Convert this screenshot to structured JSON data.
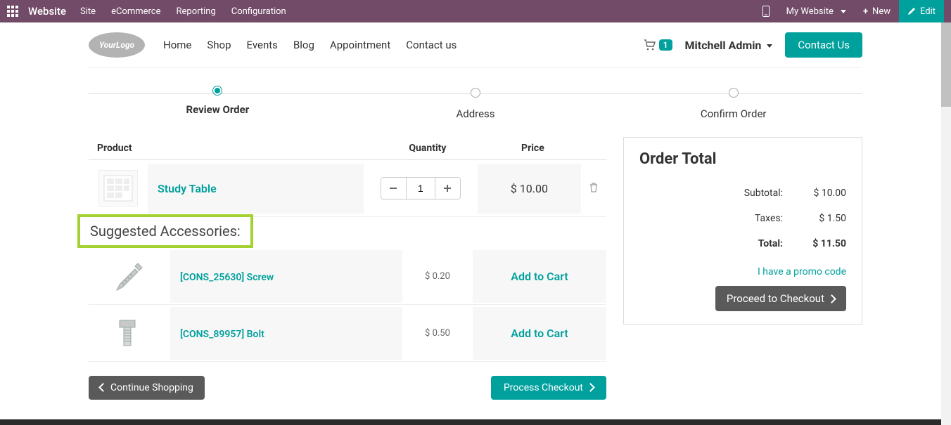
{
  "topbar": {
    "brand": "Website",
    "menu": [
      "Site",
      "eCommerce",
      "Reporting",
      "Configuration"
    ],
    "my_website": "My Website",
    "new": "New",
    "edit": "Edit"
  },
  "sitenav": {
    "logo_text": "YourLogo",
    "menu": [
      "Home",
      "Shop",
      "Events",
      "Blog",
      "Appointment",
      "Contact us"
    ],
    "cart_count": "1",
    "user": "Mitchell Admin",
    "contact_btn": "Contact Us"
  },
  "steps": [
    {
      "label": "Review Order",
      "active": true
    },
    {
      "label": "Address",
      "active": false
    },
    {
      "label": "Confirm Order",
      "active": false
    }
  ],
  "cart": {
    "headers": {
      "product": "Product",
      "quantity": "Quantity",
      "price": "Price"
    },
    "items": [
      {
        "name": "Study Table",
        "qty": "1",
        "price": "$ 10.00"
      }
    ]
  },
  "suggested": {
    "heading": "Suggested Accessories:",
    "items": [
      {
        "name": "[CONS_25630] Screw",
        "price": "$ 0.20",
        "add": "Add to Cart"
      },
      {
        "name": "[CONS_89957] Bolt",
        "price": "$ 0.50",
        "add": "Add to Cart"
      }
    ]
  },
  "buttons": {
    "continue_shopping": "Continue Shopping",
    "process_checkout": "Process Checkout"
  },
  "order_total": {
    "title": "Order Total",
    "lines": {
      "subtotal_label": "Subtotal:",
      "subtotal_value": "$ 10.00",
      "taxes_label": "Taxes:",
      "taxes_value": "$ 1.50",
      "total_label": "Total:",
      "total_value": "$ 11.50"
    },
    "promo": "I have a promo code",
    "checkout": "Proceed to Checkout"
  }
}
